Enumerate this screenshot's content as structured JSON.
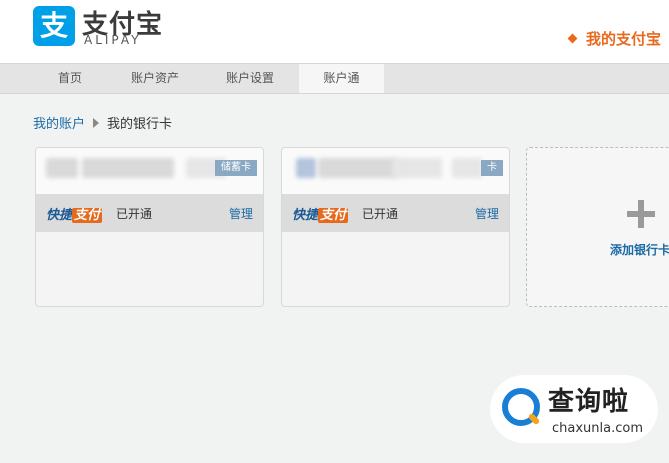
{
  "header": {
    "logo_glyph": "支",
    "logo_cn": "支付宝",
    "logo_en": "ALIPAY",
    "my_alipay": "我的支付宝"
  },
  "nav": {
    "items": [
      {
        "label": "首页"
      },
      {
        "label": "账户资产"
      },
      {
        "label": "账户设置"
      },
      {
        "label": "账户通",
        "active": true
      }
    ]
  },
  "breadcrumb": {
    "parent": "我的账户",
    "current": "我的银行卡"
  },
  "cards": [
    {
      "tag": "储蓄卡",
      "quickpay_a": "快捷",
      "quickpay_b": "支付",
      "status": "已开通",
      "manage": "管理"
    },
    {
      "tag": "卡",
      "quickpay_a": "快捷",
      "quickpay_b": "支付",
      "status": "已开通",
      "manage": "管理"
    }
  ],
  "add_card": {
    "label": "添加银行卡"
  },
  "watermark": {
    "cn": "查询啦",
    "en": "chaxunla.com"
  },
  "colors": {
    "brand_blue": "#00a0e8",
    "accent_orange": "#e86a1e",
    "link_blue": "#1b6aa5"
  }
}
